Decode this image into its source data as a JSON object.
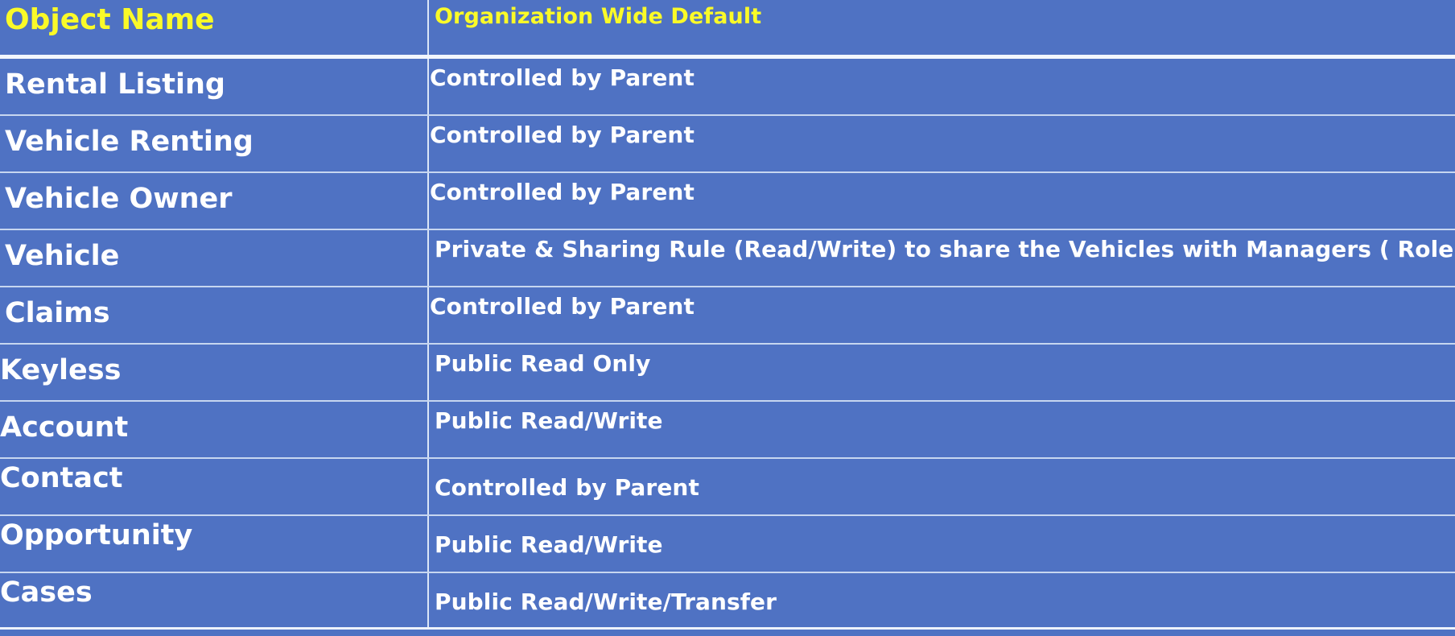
{
  "table": {
    "header": {
      "object_name": "Object Name",
      "org_wide_default": "Organization Wide Default"
    },
    "rows": [
      {
        "object": "Rental Listing",
        "default": "Controlled by Parent"
      },
      {
        "object": "Vehicle Renting",
        "default": "Controlled by Parent"
      },
      {
        "object": "Vehicle Owner",
        "default": "Controlled by Parent"
      },
      {
        "object": "Vehicle",
        "default": "Private & Sharing Rule (Read/Write)  to share the Vehicles with Managers ( Role )"
      },
      {
        "object": "Claims",
        "default": "Controlled by Parent"
      },
      {
        "object": "Keyless",
        "default": "Public Read Only"
      },
      {
        "object": "Account",
        "default": "Public Read/Write"
      },
      {
        "object": "Contact",
        "default": "Controlled by Parent"
      },
      {
        "object": "Opportunity",
        "default": "Public Read/Write"
      },
      {
        "object": "Cases",
        "default": "Public Read/Write/Transfer"
      }
    ]
  },
  "colors": {
    "cell_background": "#4f72c3",
    "header_text": "#fafa28",
    "body_text": "#ffffff",
    "grid_line": "#c7d6f0"
  }
}
